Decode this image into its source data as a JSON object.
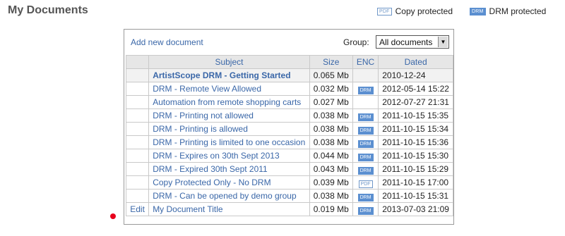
{
  "page_title": "My Documents",
  "legend": {
    "copy_badge": "PDF",
    "copy_label": "Copy protected",
    "drm_badge": "DRM",
    "drm_label": "DRM protected"
  },
  "toolbar": {
    "add_link": "Add new document",
    "group_label": "Group:",
    "group_value": "All documents"
  },
  "columns": {
    "subject": "Subject",
    "size": "Size",
    "enc": "ENC",
    "dated": "Dated"
  },
  "rows": [
    {
      "action": "",
      "subject": "ArtistScope DRM - Getting Started",
      "size": "0.065 Mb",
      "enc": "",
      "dated": "2010-12-24"
    },
    {
      "action": "",
      "subject": "DRM - Remote View Allowed",
      "size": "0.032 Mb",
      "enc": "DRM",
      "dated": "2012-05-14 15:22"
    },
    {
      "action": "",
      "subject": "Automation from remote shopping carts",
      "size": "0.027 Mb",
      "enc": "",
      "dated": "2012-07-27 21:31"
    },
    {
      "action": "",
      "subject": "DRM - Printing not allowed",
      "size": "0.038 Mb",
      "enc": "DRM",
      "dated": "2011-10-15 15:35"
    },
    {
      "action": "",
      "subject": "DRM - Printing is allowed",
      "size": "0.038 Mb",
      "enc": "DRM",
      "dated": "2011-10-15 15:34"
    },
    {
      "action": "",
      "subject": "DRM - Printing is limited to one occasion",
      "size": "0.038 Mb",
      "enc": "DRM",
      "dated": "2011-10-15 15:36"
    },
    {
      "action": "",
      "subject": "DRM - Expires on 30th Sept 2013",
      "size": "0.044 Mb",
      "enc": "DRM",
      "dated": "2011-10-15 15:30"
    },
    {
      "action": "",
      "subject": "DRM - Expired 30th Sept 2011",
      "size": "0.043 Mb",
      "enc": "DRM",
      "dated": "2011-10-15 15:29"
    },
    {
      "action": "",
      "subject": "Copy Protected Only - No DRM",
      "size": "0.039 Mb",
      "enc": "PDF",
      "dated": "2011-10-15 17:00"
    },
    {
      "action": "",
      "subject": "DRM - Can be opened by demo group",
      "size": "0.038 Mb",
      "enc": "DRM",
      "dated": "2011-10-15 15:31"
    },
    {
      "action": "Edit",
      "subject": "My Document Title",
      "size": "0.019 Mb",
      "enc": "DRM",
      "dated": "2013-07-03 21:09"
    }
  ],
  "colors": {
    "link": "#3a67a8",
    "badge_drm": "#5b8fd0",
    "marker": "#e8001c",
    "header_bg": "#e6e6e6"
  }
}
